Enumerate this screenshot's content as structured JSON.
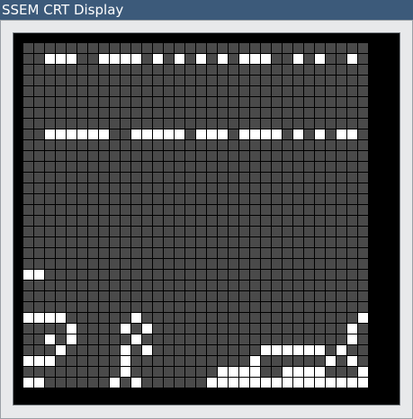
{
  "window": {
    "title": "SSEM CRT Display"
  },
  "crt": {
    "rows": 32,
    "cols": 32,
    "colors": {
      "background": "#000000",
      "bit_off": "#4a4a4a",
      "bit_on": "#ffffff"
    },
    "lit_cells": [
      [
        1,
        [
          2,
          3,
          4,
          7,
          8,
          9,
          10,
          12,
          14,
          16,
          18,
          20,
          21,
          22,
          25,
          27,
          30
        ]
      ],
      [
        8,
        [
          2,
          3,
          4,
          5,
          6,
          7,
          10,
          11,
          12,
          13,
          14,
          16,
          17,
          18,
          20,
          21,
          22,
          23,
          25,
          27,
          29,
          30
        ]
      ],
      [
        21,
        [
          0,
          1
        ]
      ],
      [
        25,
        [
          0,
          1,
          2,
          3,
          10,
          31
        ]
      ],
      [
        26,
        [
          4,
          9,
          11,
          30
        ]
      ],
      [
        27,
        [
          2,
          4,
          10,
          30
        ]
      ],
      [
        28,
        [
          3,
          9,
          11,
          22,
          23,
          24,
          25,
          26,
          27,
          29
        ]
      ],
      [
        29,
        [
          0,
          1,
          2,
          9,
          21,
          28,
          30
        ]
      ],
      [
        30,
        [
          9,
          18,
          19,
          20,
          21,
          24,
          25,
          26,
          27,
          31
        ]
      ],
      [
        31,
        [
          0,
          1,
          8,
          10,
          17,
          18,
          19,
          20,
          21,
          22,
          23,
          24,
          25,
          26,
          27,
          28,
          29,
          30,
          31
        ]
      ]
    ]
  }
}
